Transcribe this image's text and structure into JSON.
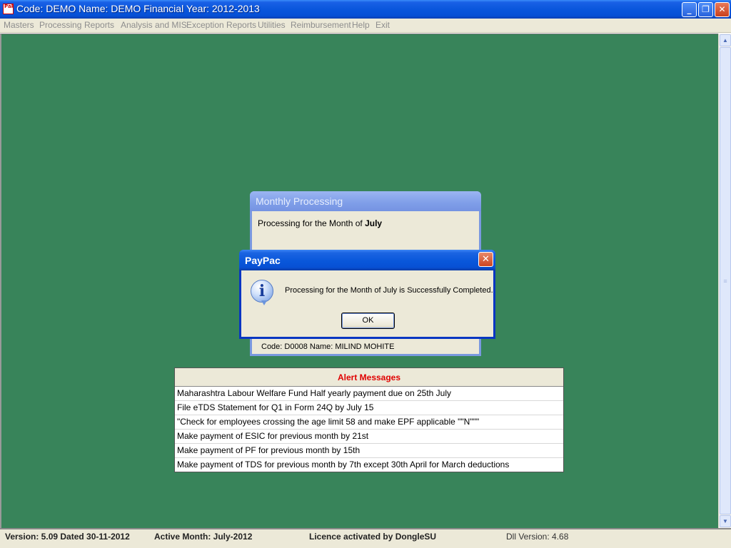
{
  "window": {
    "title": "Code: DEMO Name: DEMO Financial Year: 2012-2013",
    "icon_text": "PaPc",
    "min_symbol": "_",
    "max_symbol": "❐",
    "close_symbol": "✕"
  },
  "menu": [
    "Masters",
    "Processing",
    "Reports",
    "Analysis and MIS",
    "Exception Reports",
    "Utilities",
    "Reimbursement",
    "Help",
    "Exit"
  ],
  "monthly_processing": {
    "title": "Monthly Processing",
    "text_prefix": "Processing for the Month of",
    "month": "July",
    "code_line": "Code: D0008 Name: MILIND MOHITE"
  },
  "message_box": {
    "title": "PayPac",
    "close_symbol": "✕",
    "icon": "info-icon",
    "icon_glyph": "i",
    "message": "Processing for the Month of July is Successfully Completed.",
    "ok_label": "OK"
  },
  "alerts": {
    "header": "Alert Messages",
    "header_color": "#e00000",
    "rows": [
      "Maharashtra Labour Welfare Fund Half yearly payment due on 25th July",
      "File eTDS Statement for Q1 in Form 24Q by July 15",
      "\"Check for employees crossing the age limit 58 and make EPF applicable \"\"N\"\"\"",
      "Make payment of ESIC for previous month by 21st",
      "Make payment of PF for previous month by 15th",
      "Make payment of TDS for previous month by 7th except 30th April for March deductions"
    ]
  },
  "status_bar": {
    "version": "Version: 5.09 Dated 30-11-2012",
    "active_month": "Active Month: July-2012",
    "licence": "Licence activated by DongleSU",
    "dll_version": "Dll Version: 4.68"
  },
  "scrollbar": {
    "up_symbol": "▲",
    "down_symbol": "▼",
    "grip_symbol": "≡"
  },
  "colors": {
    "workspace": "#38845a",
    "titlebar": "#0a56dc",
    "dialog_bg": "#ece9d8"
  }
}
